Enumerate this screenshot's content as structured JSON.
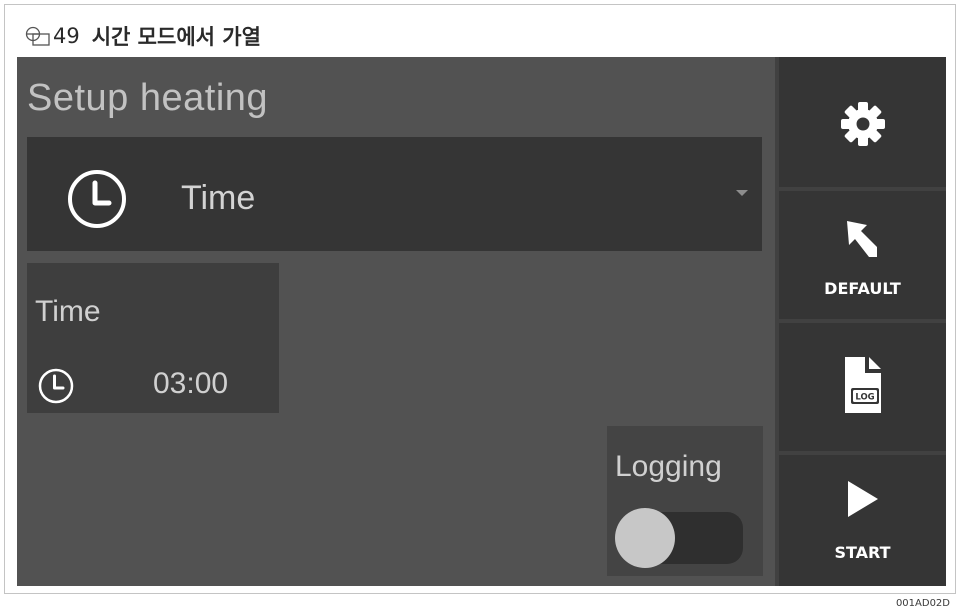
{
  "figure": {
    "number": "49",
    "title": "시간 모드에서 가열",
    "image_code": "001AD02D"
  },
  "screen": {
    "title": "Setup heating",
    "mode_select": {
      "icon": "clock-icon",
      "value": "Time"
    },
    "time_card": {
      "label": "Time",
      "icon": "clock-icon",
      "value": "03:00"
    },
    "logging": {
      "label": "Logging",
      "enabled": false
    }
  },
  "side_panel": {
    "buttons": [
      {
        "icon": "gear-icon",
        "label": ""
      },
      {
        "icon": "reset-arrow-icon",
        "label": "DEFAULT"
      },
      {
        "icon": "log-file-icon",
        "label": ""
      },
      {
        "icon": "play-icon",
        "label": "START"
      }
    ]
  },
  "colors": {
    "screen_bg": "#525252",
    "panel_dark": "#353535",
    "text_light": "#d0d0d0",
    "icon_white": "#ffffff"
  }
}
